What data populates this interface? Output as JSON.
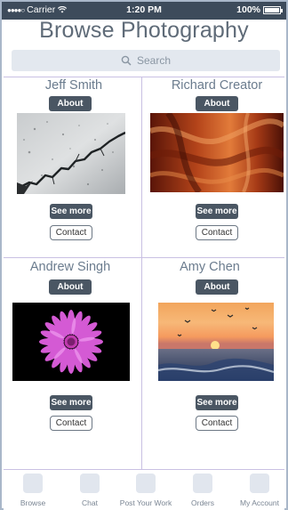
{
  "status_bar": {
    "signal": "●●●●○",
    "carrier": "Carrier",
    "time": "1:20 PM",
    "battery": "100%"
  },
  "page": {
    "title": "Browse Photography"
  },
  "search": {
    "placeholder": "Search"
  },
  "photographers": [
    {
      "name": "Jeff Smith",
      "about": "About",
      "see_more": "See more",
      "contact": "Contact",
      "photo": "cracked-ice"
    },
    {
      "name": "Richard Creator",
      "about": "About",
      "see_more": "See more",
      "contact": "Contact",
      "photo": "red-canyon"
    },
    {
      "name": "Andrew Singh",
      "about": "About",
      "see_more": "See more",
      "contact": "Contact",
      "photo": "pink-daisy"
    },
    {
      "name": "Amy Chen",
      "about": "About",
      "see_more": "See more",
      "contact": "Contact",
      "photo": "ocean-sunset"
    }
  ],
  "tabs": [
    {
      "label": "Browse",
      "icon": "browse-icon"
    },
    {
      "label": "Chat",
      "icon": "chat-icon"
    },
    {
      "label": "Post Your Work",
      "icon": "post-icon"
    },
    {
      "label": "Orders",
      "icon": "orders-icon"
    },
    {
      "label": "My Account",
      "icon": "account-icon"
    }
  ]
}
